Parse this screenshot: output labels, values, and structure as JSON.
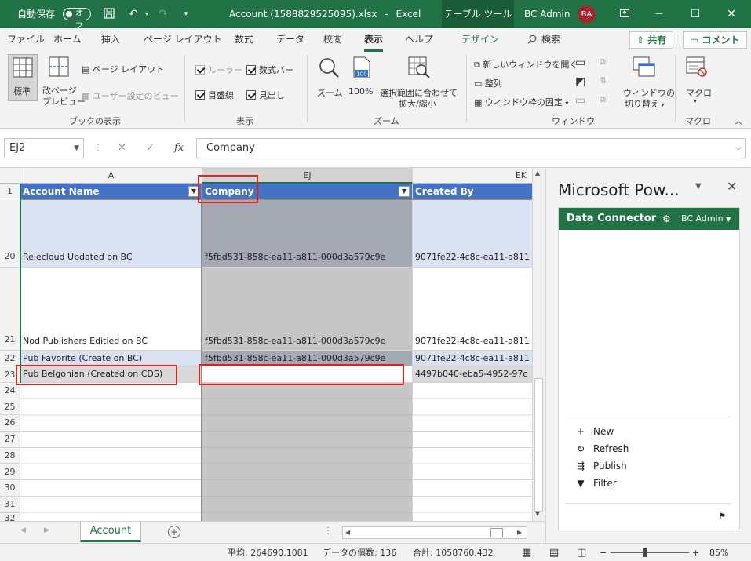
{
  "titlebar": {
    "autosave_label": "自動保存",
    "autosave_state": "オフ",
    "filename": "Account (1588829525095).xlsx",
    "separator": "-",
    "app": "Excel",
    "context_tab": "テーブル ツール",
    "user": "BC Admin",
    "initials": "BA"
  },
  "tabs": [
    "ファイル",
    "ホーム",
    "挿入",
    "ページ レイアウト",
    "数式",
    "データ",
    "校閲",
    "表示",
    "ヘルプ",
    "デザイン"
  ],
  "tell_me": "検索",
  "share": "共有",
  "comment": "コメント",
  "ribbon": {
    "views": {
      "normal": "標準",
      "pagebreak1": "改ページ",
      "pagebreak2": "プレビュー",
      "pagelayout": "ページ レイアウト",
      "custom": "ユーザー設定のビュー",
      "label": "ブックの表示"
    },
    "show": {
      "ruler": "ルーラー",
      "formulabar": "数式バー",
      "gridlines": "目盛線",
      "headings": "見出し",
      "label": "表示"
    },
    "zoom": {
      "zoom": "ズーム",
      "hundred": "100%",
      "hundred_icon": "100",
      "selection1": "選択範囲に合わせて",
      "selection2": "拡大/縮小",
      "label": "ズーム"
    },
    "window": {
      "newwindow": "新しいウィンドウを開く",
      "arrange": "整列",
      "freeze": "ウィンドウ枠の固定",
      "switch1": "ウィンドウの",
      "switch2": "切り替え",
      "label": "ウィンドウ"
    },
    "macro": {
      "macro": "マクロ",
      "label": "マクロ"
    }
  },
  "namebox": "EJ2",
  "formula": "Company",
  "grid": {
    "col_headers": [
      "A",
      "EJ",
      "EK"
    ],
    "header_row": {
      "num": "1",
      "cells": [
        "Account Name",
        "Company",
        "Created By"
      ]
    },
    "rows": [
      {
        "num": "20",
        "a": "Relecloud Updated on BC",
        "ej": "f5fbd531-858c-ea11-a811-000d3a579c9e",
        "ek": "9071fe22-4c8c-ea11-a811"
      },
      {
        "num": "21",
        "a": "Nod Publishers Editied on BC",
        "ej": "f5fbd531-858c-ea11-a811-000d3a579c9e",
        "ek": "9071fe22-4c8c-ea11-a811"
      },
      {
        "num": "22",
        "a": "Pub Favorite (Create on BC)",
        "ej": "f5fbd531-858c-ea11-a811-000d3a579c9e",
        "ek": "9071fe22-4c8c-ea11-a811"
      },
      {
        "num": "23",
        "a": "Pub Belgonian (Created on CDS)",
        "ej": "",
        "ek": "4497b040-eba5-4952-97c"
      },
      {
        "num": "24",
        "a": "",
        "ej": "",
        "ek": ""
      },
      {
        "num": "25",
        "a": "",
        "ej": "",
        "ek": ""
      },
      {
        "num": "26",
        "a": "",
        "ej": "",
        "ek": ""
      },
      {
        "num": "27",
        "a": "",
        "ej": "",
        "ek": ""
      },
      {
        "num": "28",
        "a": "",
        "ej": "",
        "ek": ""
      },
      {
        "num": "29",
        "a": "",
        "ej": "",
        "ek": ""
      },
      {
        "num": "30",
        "a": "",
        "ej": "",
        "ek": ""
      },
      {
        "num": "31",
        "a": "",
        "ej": "",
        "ek": ""
      },
      {
        "num": "32",
        "a": "",
        "ej": "",
        "ek": ""
      }
    ]
  },
  "sheet_tab": "Account",
  "status": {
    "average": "平均: 264690.1081",
    "count": "データの個数: 136",
    "sum": "合計: 1058760.432",
    "zoom": "85%"
  },
  "pane": {
    "title": "Microsoft Pow...",
    "addin_title": "Data Connector",
    "user": "BC Admin",
    "actions": {
      "new": "New",
      "refresh": "Refresh",
      "publish": "Publish",
      "filter": "Filter"
    }
  }
}
